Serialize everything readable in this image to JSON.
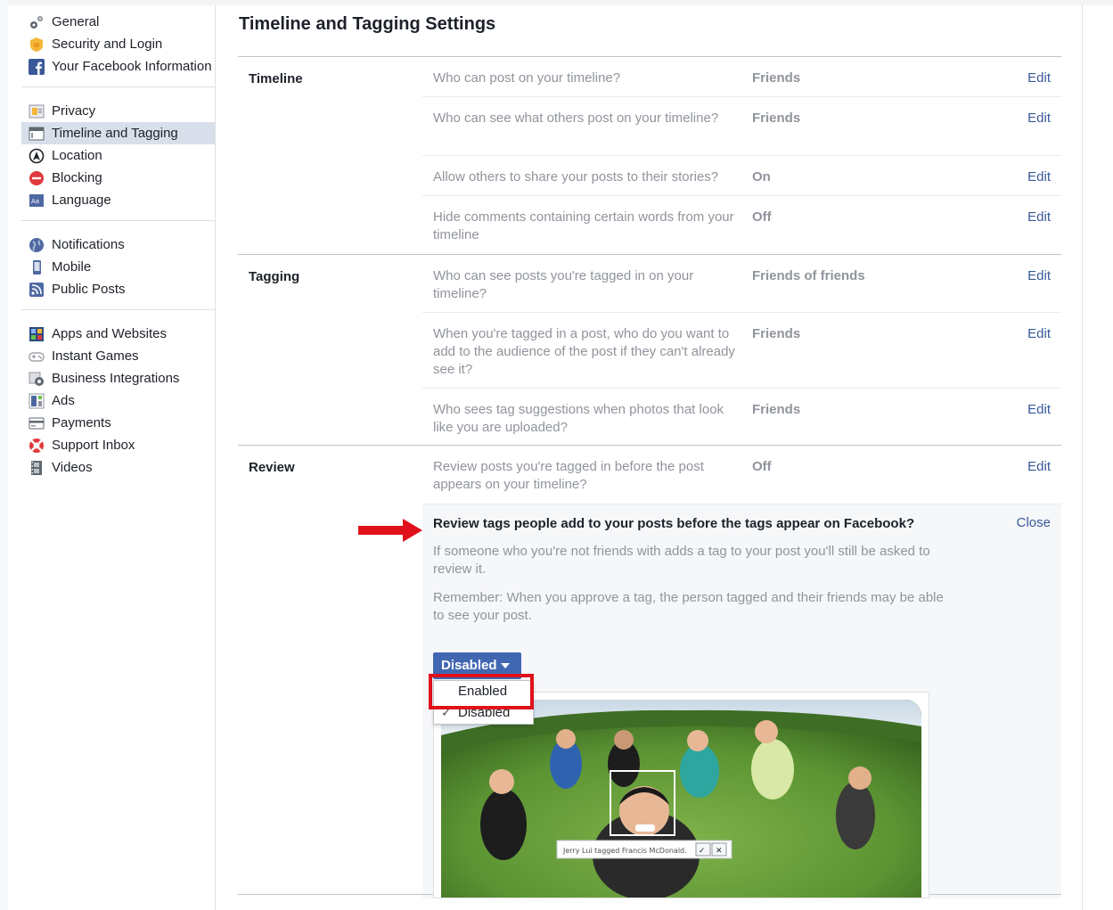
{
  "sidebar": {
    "groups": [
      [
        {
          "label": "General",
          "icon": "gears-icon"
        },
        {
          "label": "Security and Login",
          "icon": "badge-icon"
        },
        {
          "label": "Your Facebook Information",
          "icon": "facebook-icon"
        }
      ],
      [
        {
          "label": "Privacy",
          "icon": "lock-icon"
        },
        {
          "label": "Timeline and Tagging",
          "icon": "timeline-icon"
        },
        {
          "label": "Location",
          "icon": "location-icon"
        },
        {
          "label": "Blocking",
          "icon": "blocking-icon"
        },
        {
          "label": "Language",
          "icon": "language-icon"
        }
      ],
      [
        {
          "label": "Notifications",
          "icon": "globe-icon"
        },
        {
          "label": "Mobile",
          "icon": "mobile-icon"
        },
        {
          "label": "Public Posts",
          "icon": "rss-icon"
        }
      ],
      [
        {
          "label": "Apps and Websites",
          "icon": "apps-icon"
        },
        {
          "label": "Instant Games",
          "icon": "gamepad-icon"
        },
        {
          "label": "Business Integrations",
          "icon": "business-icon"
        },
        {
          "label": "Ads",
          "icon": "ads-icon"
        },
        {
          "label": "Payments",
          "icon": "card-icon"
        },
        {
          "label": "Support Inbox",
          "icon": "lifebuoy-icon"
        },
        {
          "label": "Videos",
          "icon": "film-icon"
        }
      ]
    ],
    "active": "Timeline and Tagging"
  },
  "main": {
    "title": "Timeline and Tagging Settings",
    "sections": [
      {
        "label": "Timeline",
        "rows": [
          {
            "question": "Who can post on your timeline?",
            "value": "Friends",
            "action": "Edit"
          },
          {
            "question": "Who can see what others post on your timeline?",
            "value": "Friends",
            "action": "Edit"
          },
          {
            "question": "Allow others to share your posts to their stories?",
            "value": "On",
            "action": "Edit"
          },
          {
            "question": "Hide comments containing certain words from your timeline",
            "value": "Off",
            "action": "Edit"
          }
        ]
      },
      {
        "label": "Tagging",
        "rows": [
          {
            "question": "Who can see posts you're tagged in on your timeline?",
            "value": "Friends of friends",
            "action": "Edit"
          },
          {
            "question": "When you're tagged in a post, who do you want to add to the audience of the post if they can't already see it?",
            "value": "Friends",
            "action": "Edit"
          },
          {
            "question": "Who sees tag suggestions when photos that look like you are uploaded?",
            "value": "Friends",
            "action": "Edit"
          }
        ]
      },
      {
        "label": "Review",
        "rows": [
          {
            "question": "Review posts you're tagged in before the post appears on your timeline?",
            "value": "Off",
            "action": "Edit"
          }
        ]
      }
    ],
    "expanded": {
      "question": "Review tags people add to your posts before the tags appear on Facebook?",
      "close_label": "Close",
      "para1": "If someone who you're not friends with adds a tag to your post you'll still be asked to review it.",
      "para2": "Remember: When you approve a tag, the person tagged and their friends may be able to see your post.",
      "dropdown_value": "Disabled",
      "options": [
        {
          "label": "Enabled",
          "checked": false
        },
        {
          "label": "Disabled",
          "checked": true
        }
      ],
      "photo_caption": "Jerry Lui tagged Francis McDonald."
    }
  },
  "colors": {
    "link": "#365899",
    "button": "#4267b2",
    "annotation_red": "#e0111b",
    "active_bg": "#d8dfea"
  }
}
